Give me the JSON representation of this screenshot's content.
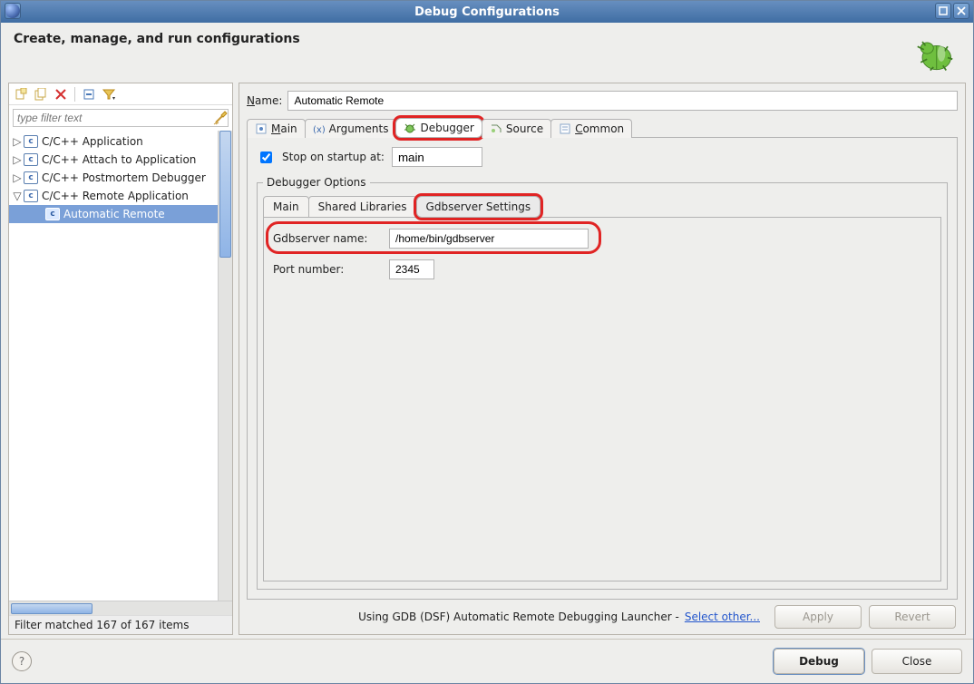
{
  "window": {
    "title": "Debug Configurations"
  },
  "header": {
    "title": "Create, manage, and run configurations"
  },
  "left": {
    "filter_placeholder": "type filter text",
    "tree": [
      {
        "label": "C/C++ Application",
        "expanded": false
      },
      {
        "label": "C/C++ Attach to Application",
        "expanded": false
      },
      {
        "label": "C/C++ Postmortem Debugger",
        "expanded": false
      },
      {
        "label": "C/C++ Remote Application",
        "expanded": true,
        "children": [
          {
            "label": "Automatic Remote",
            "selected": true
          }
        ]
      }
    ],
    "filter_status": "Filter matched 167 of 167 items"
  },
  "form": {
    "name_label_pre": "N",
    "name_label_rest": "ame:",
    "name_value": "Automatic Remote",
    "tabs": {
      "main_pre": "M",
      "main_rest": "ain",
      "arguments": "Arguments",
      "debugger": "Debugger",
      "source": "Source",
      "common_pre": "C",
      "common_rest": "ommon"
    },
    "stop_checked": true,
    "stop_label": "Stop on startup at:",
    "stop_value": "main",
    "debugger_options_legend": "Debugger Options",
    "subtabs": {
      "main": "Main",
      "shared": "Shared Libraries",
      "gdbserver": "Gdbserver Settings"
    },
    "gdbserver_name_label": "Gdbserver name:",
    "gdbserver_name_value": "/home/bin/gdbserver",
    "port_label": "Port number:",
    "port_value": "2345"
  },
  "launcher": {
    "text": "Using GDB (DSF) Automatic Remote Debugging Launcher -",
    "link": "Select other..."
  },
  "buttons": {
    "apply": "Apply",
    "revert": "Revert",
    "debug": "Debug",
    "close": "Close"
  }
}
